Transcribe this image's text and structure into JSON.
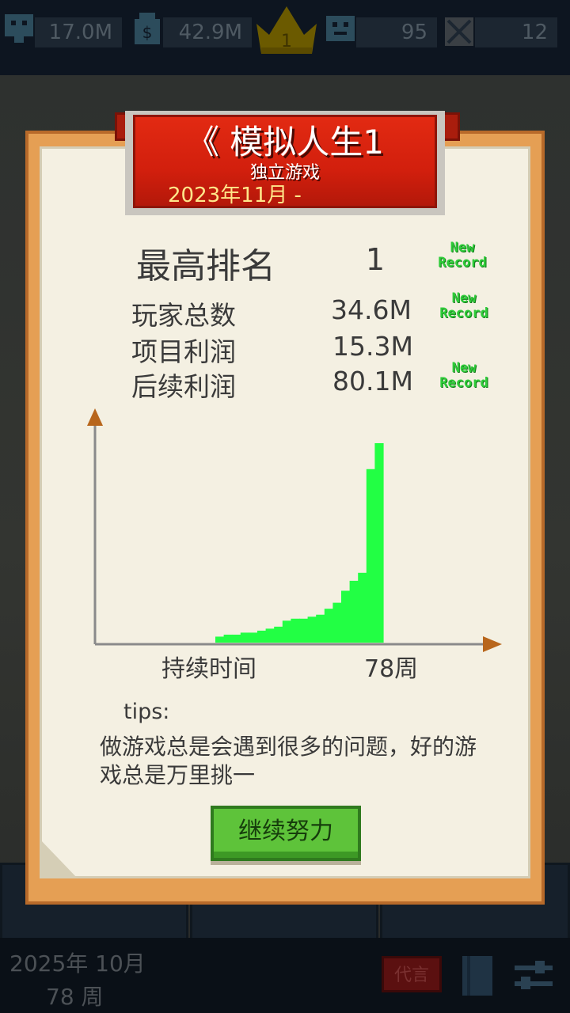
{
  "top_bar": {
    "fans": "17.0M",
    "money": "42.9M",
    "rank": "1",
    "happiness": "95",
    "locked": "12"
  },
  "dialog": {
    "title": "《 模拟人生1",
    "genre": "独立游戏",
    "release": "2023年11月 -",
    "stats": {
      "rank_label": "最高排名",
      "rank_value": "1",
      "players_label": "玩家总数",
      "players_value": "34.6M",
      "profit_label": "项目利润",
      "profit_value": "15.3M",
      "after_label": "后续利润",
      "after_value": "80.1M",
      "badge_line1": "New",
      "badge_line2": "Record"
    },
    "tips_heading": "tips:",
    "tips_text": "做游戏总是会遇到很多的问题，好的游戏总是万里挑一",
    "continue_button": "继续努力"
  },
  "chart_data": {
    "type": "bar",
    "xlabel": "持续时间",
    "x_end_label": "78周",
    "color": "#22ff44",
    "values": [
      0.03,
      0.04,
      0.04,
      0.05,
      0.05,
      0.06,
      0.07,
      0.08,
      0.11,
      0.12,
      0.12,
      0.13,
      0.14,
      0.17,
      0.2,
      0.26,
      0.31,
      0.35,
      0.87,
      1.0
    ]
  },
  "bottom_bar": {
    "date": "2025年 10月",
    "week": "78 周",
    "replace_label": "代言"
  }
}
